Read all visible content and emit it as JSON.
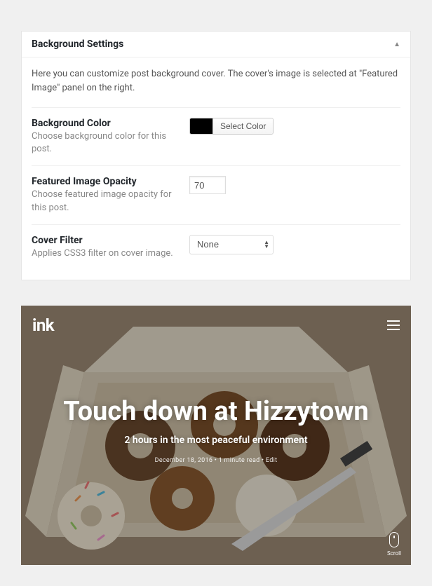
{
  "panel": {
    "title": "Background Settings",
    "intro": "Here you can customize post background cover. The cover's image is selected at \"Featured Image\" panel on the right."
  },
  "settings": {
    "bg_color": {
      "label": "Background Color",
      "desc": "Choose background color for this post.",
      "swatch": "#000000",
      "button": "Select Color"
    },
    "opacity": {
      "label": "Featured Image Opacity",
      "desc": "Choose featured image opacity for this post.",
      "value": "70"
    },
    "filter": {
      "label": "Cover Filter",
      "desc": "Applies CSS3 filter on cover image.",
      "value": "None"
    }
  },
  "preview": {
    "logo": "ink",
    "title": "Touch down at Hizzytown",
    "subtitle": "2 hours in the most peaceful environment",
    "meta": "December 18, 2016  •  1 minute read  •  Edit",
    "scroll_label": "Scroll"
  }
}
